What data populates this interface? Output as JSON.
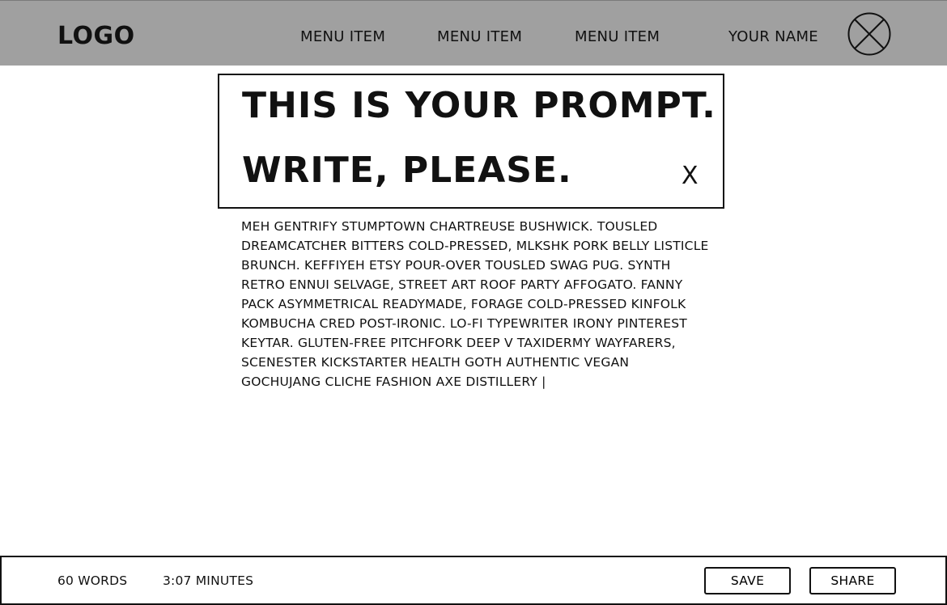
{
  "header": {
    "logo": "LOGO",
    "menu": [
      {
        "label": "MENU ITEM"
      },
      {
        "label": "MENU ITEM"
      },
      {
        "label": "MENU ITEM"
      }
    ],
    "user_name": "YOUR NAME",
    "avatar_icon": "avatar-placeholder-icon"
  },
  "prompt": {
    "line1": "THIS IS YOUR PROMPT.",
    "line2": "WRITE, PLEASE.",
    "close_label": "X"
  },
  "editor": {
    "text": "MEH GENTRIFY STUMPTOWN CHARTREUSE BUSHWICK. TOUSLED DREAMCATCHER BITTERS COLD-PRESSED, MLKSHK PORK BELLY LISTICLE BRUNCH. KEFFIYEH ETSY POUR-OVER TOUSLED SWAG PUG. SYNTH RETRO ENNUI SELVAGE, STREET ART ROOF PARTY AFFOGATO. FANNY PACK ASYMMETRICAL READYMADE, FORAGE COLD-PRESSED KINFOLK KOMBUCHA CRED POST-IRONIC. LO-FI TYPEWRITER IRONY PINTEREST KEYTAR. GLUTEN-FREE PITCHFORK DEEP V TAXIDERMY WAYFARERS, SCENESTER KICKSTARTER HEALTH GOTH AUTHENTIC VEGAN GOCHUJANG CLICHE FASHION AXE DISTILLERY |"
  },
  "footer": {
    "word_count": "60 WORDS",
    "time": "3:07 MINUTES",
    "save_label": "SAVE",
    "share_label": "SHARE"
  },
  "colors": {
    "header_bg": "#a0a0a0",
    "text": "#111111",
    "background": "#ffffff"
  }
}
